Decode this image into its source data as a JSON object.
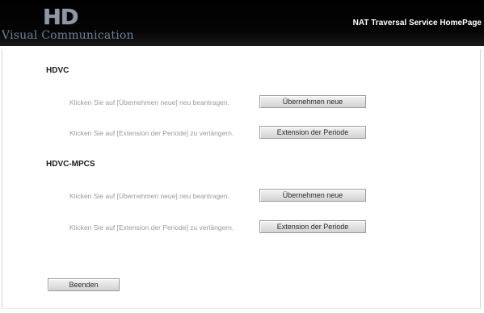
{
  "header": {
    "logo_mark": "HD",
    "logo_text": "Visual Communication",
    "title": "NAT Traversal Service HomePage"
  },
  "sections": [
    {
      "title": "HDVC",
      "rows": [
        {
          "label": "Klicken Sie auf [Übernehmen neue] neu beantragen.",
          "button": "Übernehmen neue"
        },
        {
          "label": "Klicken Sie auf [Extension der Periode] zu verlängern.",
          "button": "Extension der Periode"
        }
      ]
    },
    {
      "title": "HDVC-MPCS",
      "rows": [
        {
          "label": "Klicken Sie auf [Übernehmen neue] neu beantragen.",
          "button": "Übernehmen neue"
        },
        {
          "label": "Klicken Sie auf [Extension der Periode] zu verlängern.",
          "button": "Extension der Periode"
        }
      ]
    }
  ],
  "footer": {
    "exit_label": "Beenden"
  }
}
